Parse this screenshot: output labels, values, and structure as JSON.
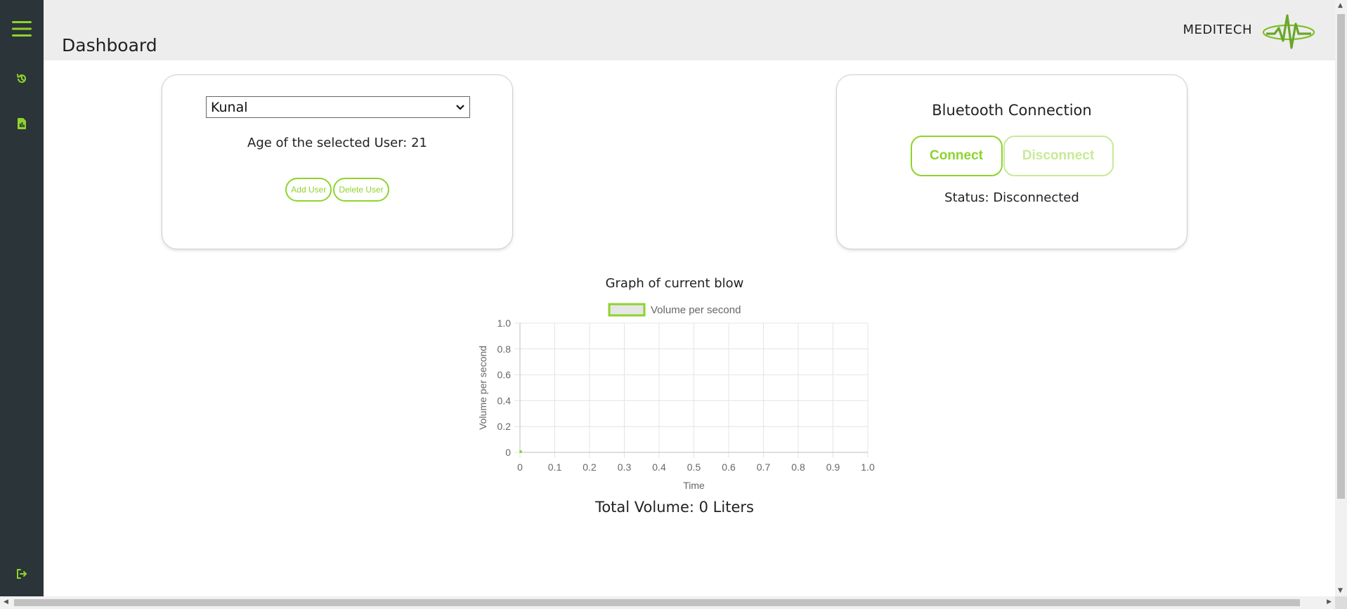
{
  "sidebar": {
    "icons": [
      "menu-icon",
      "history-icon",
      "report-icon",
      "logout-icon"
    ]
  },
  "header": {
    "title": "Dashboard",
    "brand": "MEDITECH"
  },
  "user_card": {
    "selected_user": "Kunal",
    "age_text": "Age of the selected User: 21",
    "add_user_label": "Add User",
    "delete_user_label": "Delete User"
  },
  "bluetooth_card": {
    "title": "Bluetooth Connection",
    "connect_label": "Connect",
    "disconnect_label": "Disconnect",
    "status_text": "Status: Disconnected"
  },
  "graph": {
    "title": "Graph of current blow",
    "total_volume": "Total Volume: 0 Liters"
  },
  "chart_data": {
    "type": "line",
    "title": "Graph of current blow",
    "xlabel": "Time",
    "ylabel": "Volume per second",
    "xlim": [
      0,
      1.0
    ],
    "ylim": [
      0,
      1.0
    ],
    "x_ticks": [
      "0",
      "0.1",
      "0.2",
      "0.3",
      "0.4",
      "0.5",
      "0.6",
      "0.7",
      "0.8",
      "0.9",
      "1.0"
    ],
    "y_ticks": [
      "0",
      "0.2",
      "0.4",
      "0.6",
      "0.8",
      "1.0"
    ],
    "grid": true,
    "legend": "top",
    "series": [
      {
        "name": "Volume per second",
        "x": [
          0
        ],
        "y": [
          0
        ],
        "color": "#8ed32c"
      }
    ]
  },
  "colors": {
    "accent": "#8ed32c",
    "accent_light": "#c7ea98",
    "sidebar": "#2b3438",
    "header": "#eeeded"
  }
}
